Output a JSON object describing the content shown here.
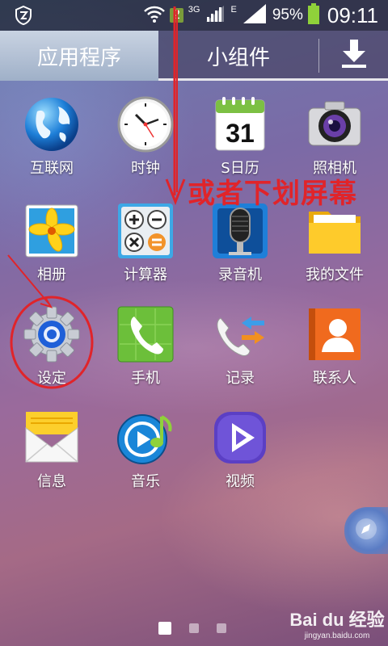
{
  "status_bar": {
    "sim_slot": "2",
    "network_type_1": "3G",
    "network_type_2": "E",
    "battery_percent": "95%",
    "time": "09:11"
  },
  "tabs": {
    "apps": "应用程序",
    "widgets": "小组件"
  },
  "apps": [
    {
      "label": "互联网",
      "icon": "globe-icon"
    },
    {
      "label": "时钟",
      "icon": "clock-icon"
    },
    {
      "label": "S日历",
      "icon": "calendar-icon",
      "icon_text": "31"
    },
    {
      "label": "照相机",
      "icon": "camera-icon"
    },
    {
      "label": "相册",
      "icon": "gallery-icon"
    },
    {
      "label": "计算器",
      "icon": "calculator-icon"
    },
    {
      "label": "录音机",
      "icon": "microphone-icon"
    },
    {
      "label": "我的文件",
      "icon": "folder-icon"
    },
    {
      "label": "设定",
      "icon": "gear-icon"
    },
    {
      "label": "手机",
      "icon": "phone-icon"
    },
    {
      "label": "记录",
      "icon": "call-log-icon"
    },
    {
      "label": "联系人",
      "icon": "contacts-icon"
    },
    {
      "label": "信息",
      "icon": "message-icon"
    },
    {
      "label": "音乐",
      "icon": "music-icon"
    },
    {
      "label": "视频",
      "icon": "video-icon"
    }
  ],
  "annotation": {
    "text": "或者下划屏幕",
    "color": "#e0242a"
  },
  "pagination": {
    "current": 1,
    "total": 3
  },
  "watermark": {
    "main": "Bai du 经验",
    "sub": "jingyan.baidu.com"
  }
}
